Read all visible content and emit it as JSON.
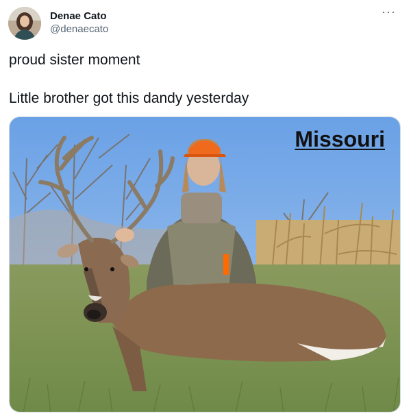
{
  "tweet": {
    "author": {
      "display_name": "Denae Cato",
      "handle": "@denaecato",
      "avatar_icon": "avatar-photo"
    },
    "more_icon": "more-horizontal-icon",
    "text_lines": [
      "proud sister moment",
      "Little brother got this dandy yesterday"
    ],
    "media": {
      "overlay_text": "Missouri"
    }
  },
  "colors": {
    "text_primary": "#0f1419",
    "text_secondary": "#536471",
    "border": "#cfd9de"
  }
}
